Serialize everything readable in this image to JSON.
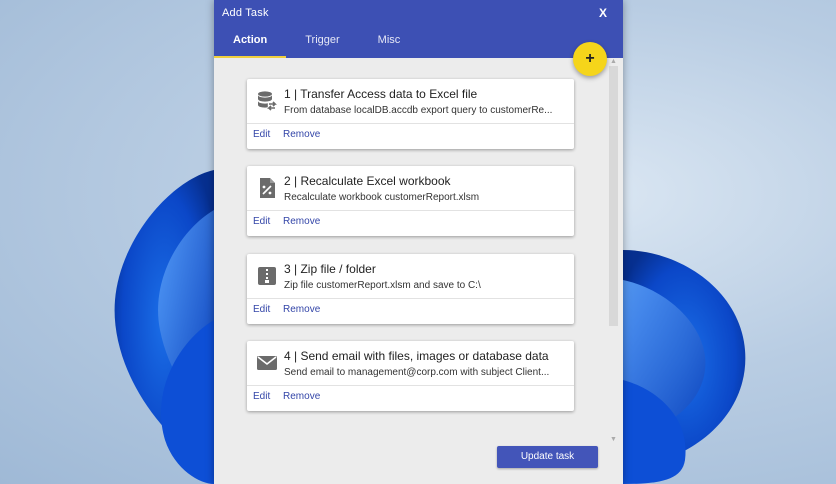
{
  "dialog": {
    "title": "Add Task",
    "close_label": "X",
    "fab_label": "+",
    "update_label": "Update task"
  },
  "tabs": [
    {
      "label": "Action",
      "active": true
    },
    {
      "label": "Trigger",
      "active": false
    },
    {
      "label": "Misc",
      "active": false
    }
  ],
  "actions": [
    {
      "title": "1 | Transfer Access data to Excel file",
      "description": "From database localDB.accdb export query to customerRe...",
      "icon": "database-transfer-icon",
      "edit": "Edit",
      "remove": "Remove"
    },
    {
      "title": "2 | Recalculate Excel workbook",
      "description": "Recalculate workbook customerReport.xlsm",
      "icon": "calculator-icon",
      "edit": "Edit",
      "remove": "Remove"
    },
    {
      "title": "3 | Zip file / folder",
      "description": "Zip file customerReport.xlsm and save to C:\\",
      "icon": "zip-icon",
      "edit": "Edit",
      "remove": "Remove"
    },
    {
      "title": "4 | Send email with files, images or database data",
      "description": "Send email to management@corp.com with subject Client...",
      "icon": "email-icon",
      "edit": "Edit",
      "remove": "Remove"
    }
  ],
  "colors": {
    "titlebar": "#3d50b4",
    "tab_indicator": "#f0cf3e",
    "fab": "#f5d51a",
    "link": "#3345a8",
    "button": "#4355b9"
  }
}
